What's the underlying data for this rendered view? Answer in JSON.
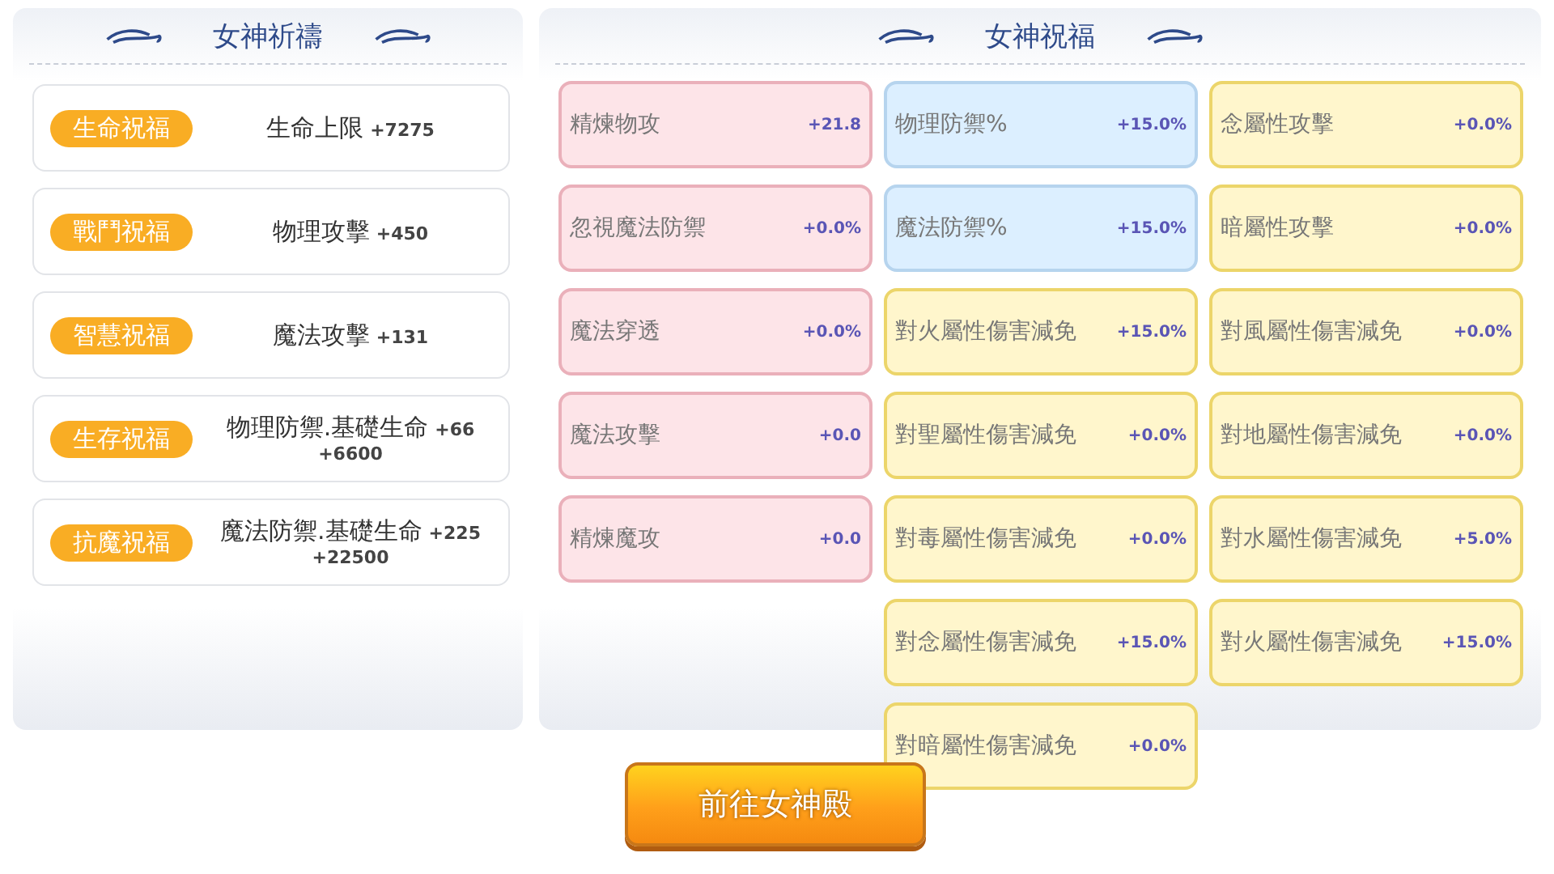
{
  "prayer_panel": {
    "title": "女神祈禱",
    "blessings": [
      {
        "badge": "生命祝福",
        "stat": "生命上限",
        "value": "+7275"
      },
      {
        "badge": "戰鬥祝福",
        "stat": "物理攻擊",
        "value": "+450"
      },
      {
        "badge": "智慧祝福",
        "stat": "魔法攻擊",
        "value": "+131"
      },
      {
        "badge": "生存祝福",
        "stat": "物理防禦.基礎生命",
        "value": "+66",
        "value_2": "+6600"
      },
      {
        "badge": "抗魔祝福",
        "stat": "魔法防禦.基礎生命",
        "value": "+225",
        "value_2": "+22500"
      }
    ]
  },
  "blessing_panel": {
    "title": "女神祝福",
    "columns": [
      [
        {
          "name": "精煉物攻",
          "value": "+21.8",
          "color": "#fde4e8"
        },
        {
          "name": "忽視魔法防禦",
          "value": "+0.0%",
          "color": "#fde4e8"
        },
        {
          "name": "魔法穿透",
          "value": "+0.0%",
          "color": "#fde4e8"
        },
        {
          "name": "魔法攻擊",
          "value": "+0.0",
          "color": "#fde4e8"
        },
        {
          "name": "精煉魔攻",
          "value": "+0.0",
          "color": "#fde4e8"
        }
      ],
      [
        {
          "name": "物理防禦%",
          "value": "+15.0%",
          "color": "#dcefff"
        },
        {
          "name": "魔法防禦%",
          "value": "+15.0%",
          "color": "#dcefff"
        },
        {
          "name": "對火屬性傷害減免",
          "value": "+15.0%",
          "color": "#fff6cc"
        },
        {
          "name": "對聖屬性傷害減免",
          "value": "+0.0%",
          "color": "#fff6cc"
        },
        {
          "name": "對毒屬性傷害減免",
          "value": "+0.0%",
          "color": "#fff6cc"
        },
        {
          "name": "對念屬性傷害減免",
          "value": "+15.0%",
          "color": "#fff6cc"
        },
        {
          "name": "對暗屬性傷害減免",
          "value": "+0.0%",
          "color": "#fff6cc"
        }
      ],
      [
        {
          "name": "念屬性攻擊",
          "value": "+0.0%",
          "color": "#fff6cc"
        },
        {
          "name": "暗屬性攻擊",
          "value": "+0.0%",
          "color": "#fff6cc"
        },
        {
          "name": "對風屬性傷害減免",
          "value": "+0.0%",
          "color": "#fff6cc"
        },
        {
          "name": "對地屬性傷害減免",
          "value": "+0.0%",
          "color": "#fff6cc"
        },
        {
          "name": "對水屬性傷害減免",
          "value": "+5.0%",
          "color": "#fff6cc"
        },
        {
          "name": "對火屬性傷害減免",
          "value": "+15.0%",
          "color": "#fff6cc"
        }
      ]
    ]
  },
  "go_button": {
    "label": "前往女神殿"
  }
}
